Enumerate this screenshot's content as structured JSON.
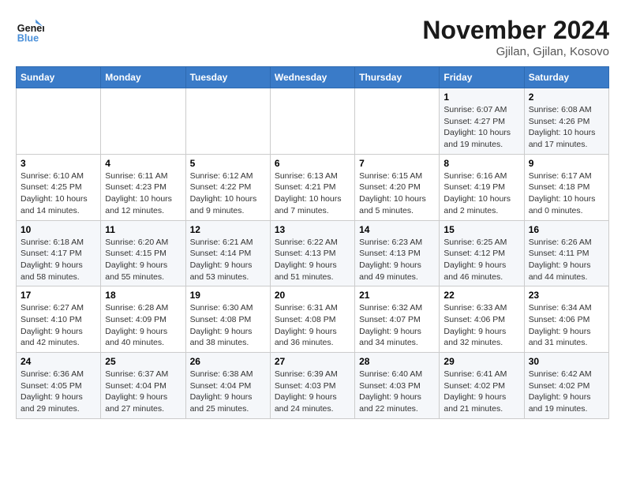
{
  "header": {
    "logo_line1": "General",
    "logo_line2": "Blue",
    "month": "November 2024",
    "location": "Gjilan, Gjilan, Kosovo"
  },
  "weekdays": [
    "Sunday",
    "Monday",
    "Tuesday",
    "Wednesday",
    "Thursday",
    "Friday",
    "Saturday"
  ],
  "weeks": [
    [
      {
        "day": "",
        "detail": ""
      },
      {
        "day": "",
        "detail": ""
      },
      {
        "day": "",
        "detail": ""
      },
      {
        "day": "",
        "detail": ""
      },
      {
        "day": "",
        "detail": ""
      },
      {
        "day": "1",
        "detail": "Sunrise: 6:07 AM\nSunset: 4:27 PM\nDaylight: 10 hours\nand 19 minutes."
      },
      {
        "day": "2",
        "detail": "Sunrise: 6:08 AM\nSunset: 4:26 PM\nDaylight: 10 hours\nand 17 minutes."
      }
    ],
    [
      {
        "day": "3",
        "detail": "Sunrise: 6:10 AM\nSunset: 4:25 PM\nDaylight: 10 hours\nand 14 minutes."
      },
      {
        "day": "4",
        "detail": "Sunrise: 6:11 AM\nSunset: 4:23 PM\nDaylight: 10 hours\nand 12 minutes."
      },
      {
        "day": "5",
        "detail": "Sunrise: 6:12 AM\nSunset: 4:22 PM\nDaylight: 10 hours\nand 9 minutes."
      },
      {
        "day": "6",
        "detail": "Sunrise: 6:13 AM\nSunset: 4:21 PM\nDaylight: 10 hours\nand 7 minutes."
      },
      {
        "day": "7",
        "detail": "Sunrise: 6:15 AM\nSunset: 4:20 PM\nDaylight: 10 hours\nand 5 minutes."
      },
      {
        "day": "8",
        "detail": "Sunrise: 6:16 AM\nSunset: 4:19 PM\nDaylight: 10 hours\nand 2 minutes."
      },
      {
        "day": "9",
        "detail": "Sunrise: 6:17 AM\nSunset: 4:18 PM\nDaylight: 10 hours\nand 0 minutes."
      }
    ],
    [
      {
        "day": "10",
        "detail": "Sunrise: 6:18 AM\nSunset: 4:17 PM\nDaylight: 9 hours\nand 58 minutes."
      },
      {
        "day": "11",
        "detail": "Sunrise: 6:20 AM\nSunset: 4:15 PM\nDaylight: 9 hours\nand 55 minutes."
      },
      {
        "day": "12",
        "detail": "Sunrise: 6:21 AM\nSunset: 4:14 PM\nDaylight: 9 hours\nand 53 minutes."
      },
      {
        "day": "13",
        "detail": "Sunrise: 6:22 AM\nSunset: 4:13 PM\nDaylight: 9 hours\nand 51 minutes."
      },
      {
        "day": "14",
        "detail": "Sunrise: 6:23 AM\nSunset: 4:13 PM\nDaylight: 9 hours\nand 49 minutes."
      },
      {
        "day": "15",
        "detail": "Sunrise: 6:25 AM\nSunset: 4:12 PM\nDaylight: 9 hours\nand 46 minutes."
      },
      {
        "day": "16",
        "detail": "Sunrise: 6:26 AM\nSunset: 4:11 PM\nDaylight: 9 hours\nand 44 minutes."
      }
    ],
    [
      {
        "day": "17",
        "detail": "Sunrise: 6:27 AM\nSunset: 4:10 PM\nDaylight: 9 hours\nand 42 minutes."
      },
      {
        "day": "18",
        "detail": "Sunrise: 6:28 AM\nSunset: 4:09 PM\nDaylight: 9 hours\nand 40 minutes."
      },
      {
        "day": "19",
        "detail": "Sunrise: 6:30 AM\nSunset: 4:08 PM\nDaylight: 9 hours\nand 38 minutes."
      },
      {
        "day": "20",
        "detail": "Sunrise: 6:31 AM\nSunset: 4:08 PM\nDaylight: 9 hours\nand 36 minutes."
      },
      {
        "day": "21",
        "detail": "Sunrise: 6:32 AM\nSunset: 4:07 PM\nDaylight: 9 hours\nand 34 minutes."
      },
      {
        "day": "22",
        "detail": "Sunrise: 6:33 AM\nSunset: 4:06 PM\nDaylight: 9 hours\nand 32 minutes."
      },
      {
        "day": "23",
        "detail": "Sunrise: 6:34 AM\nSunset: 4:06 PM\nDaylight: 9 hours\nand 31 minutes."
      }
    ],
    [
      {
        "day": "24",
        "detail": "Sunrise: 6:36 AM\nSunset: 4:05 PM\nDaylight: 9 hours\nand 29 minutes."
      },
      {
        "day": "25",
        "detail": "Sunrise: 6:37 AM\nSunset: 4:04 PM\nDaylight: 9 hours\nand 27 minutes."
      },
      {
        "day": "26",
        "detail": "Sunrise: 6:38 AM\nSunset: 4:04 PM\nDaylight: 9 hours\nand 25 minutes."
      },
      {
        "day": "27",
        "detail": "Sunrise: 6:39 AM\nSunset: 4:03 PM\nDaylight: 9 hours\nand 24 minutes."
      },
      {
        "day": "28",
        "detail": "Sunrise: 6:40 AM\nSunset: 4:03 PM\nDaylight: 9 hours\nand 22 minutes."
      },
      {
        "day": "29",
        "detail": "Sunrise: 6:41 AM\nSunset: 4:02 PM\nDaylight: 9 hours\nand 21 minutes."
      },
      {
        "day": "30",
        "detail": "Sunrise: 6:42 AM\nSunset: 4:02 PM\nDaylight: 9 hours\nand 19 minutes."
      }
    ]
  ]
}
